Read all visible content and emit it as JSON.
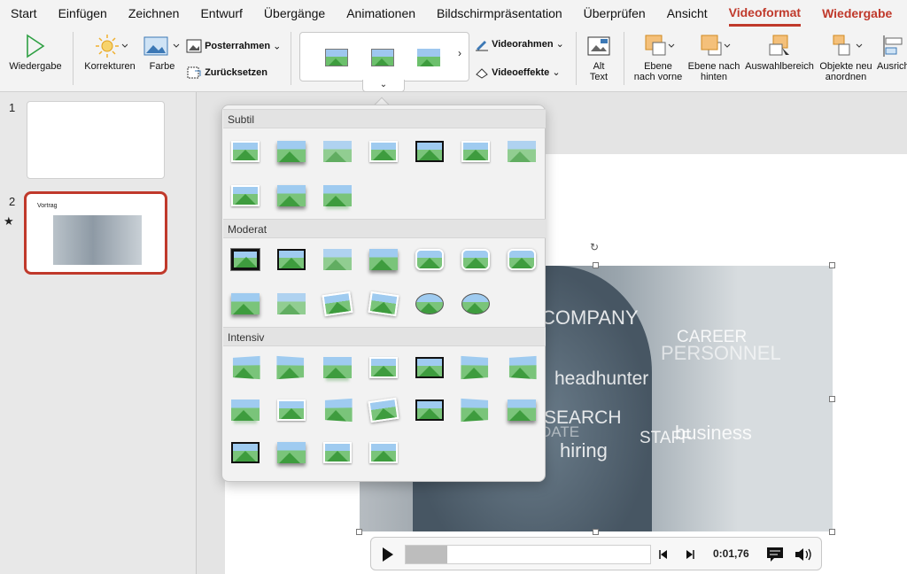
{
  "menu_tabs": [
    "Start",
    "Einfügen",
    "Zeichnen",
    "Entwurf",
    "Übergänge",
    "Animationen",
    "Bildschirmpräsentation",
    "Überprüfen",
    "Ansicht",
    "Videoformat",
    "Wiedergabe"
  ],
  "active_tab": "Videoformat",
  "ribbon": {
    "play": "Wiedergabe",
    "corrections": "Korrekturen",
    "color": "Farbe",
    "poster_frame": "Posterrahmen",
    "reset": "Zurücksetzen",
    "video_frame": "Videorahmen",
    "video_effects": "Videoeffekte",
    "alt_text_1": "Alt",
    "alt_text_2": "Text",
    "bring_forward_1": "Ebene",
    "bring_forward_2": "nach vorne",
    "send_backward_1": "Ebene nach",
    "send_backward_2": "hinten",
    "selection_pane": "Auswahlbereich",
    "reorder_1": "Objekte neu",
    "reorder_2": "anordnen",
    "align": "Ausrich"
  },
  "slides": [
    {
      "number": "1",
      "title": ""
    },
    {
      "number": "2",
      "title": "Vortrag"
    }
  ],
  "gallery": {
    "sections": [
      "Subtil",
      "Moderat",
      "Intensiv"
    ]
  },
  "video_words": [
    "COMPANY",
    "CAREER",
    "PERSONNEL",
    "headhunter",
    "SEARCH",
    "DATE",
    "STAFF",
    "business",
    "hiring"
  ],
  "player": {
    "time": "0:01,76",
    "progress_fraction": 0.17
  },
  "colors": {
    "accent": "#c0392b"
  }
}
